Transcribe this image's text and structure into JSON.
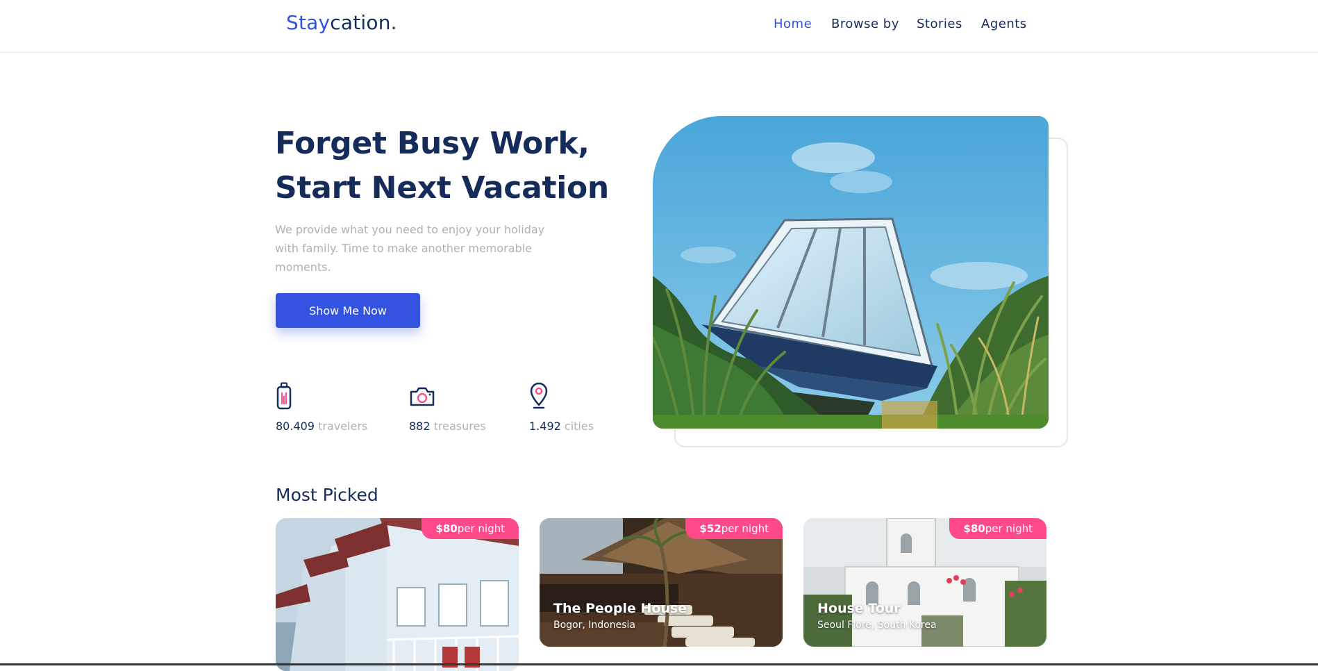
{
  "header": {
    "brand": {
      "accent": "Stay",
      "rest": "cation."
    },
    "nav": [
      {
        "label": "Home",
        "active": true
      },
      {
        "label": "Browse by",
        "active": false
      },
      {
        "label": "Stories",
        "active": false
      },
      {
        "label": "Agents",
        "active": false
      }
    ]
  },
  "hero": {
    "title_line1": "Forget Busy Work,",
    "title_line2": "Start Next Vacation",
    "description": "We provide what you need to enjoy your holiday with family. Time to make another memorable moments.",
    "cta_label": "Show Me Now",
    "stats": [
      {
        "value": "80.409",
        "unit": "travelers",
        "icon": "suitcase-icon"
      },
      {
        "value": "882",
        "unit": "treasures",
        "icon": "camera-icon"
      },
      {
        "value": "1.492",
        "unit": "cities",
        "icon": "map-pin-icon"
      }
    ],
    "image": "glass-house-on-hill"
  },
  "most_picked": {
    "title": "Most Picked",
    "cards": [
      {
        "price": "$80",
        "per": "per night",
        "name": "",
        "location": "",
        "image": "blue-beach-houses"
      },
      {
        "price": "$52",
        "per": "per night",
        "name": "The People House",
        "location": "Bogor, Indonesia",
        "image": "resort-deck"
      },
      {
        "price": "$80",
        "per": "per night",
        "name": "House Tour",
        "location": "Seoul Flore, South Korea",
        "image": "white-villa"
      }
    ]
  },
  "colors": {
    "primary": "#3252df",
    "navy": "#152c5b",
    "muted": "#b0b0b0",
    "pink": "#ff498b"
  }
}
